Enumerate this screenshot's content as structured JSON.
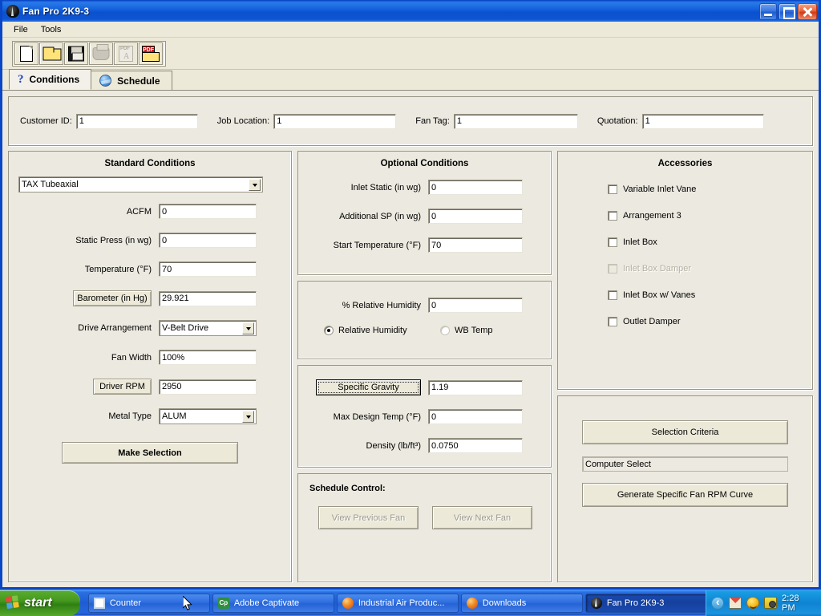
{
  "window": {
    "title": "Fan Pro 2K9-3",
    "icon": "fan-icon",
    "controls": {
      "minimize": "Minimize",
      "maximize": "Maximize",
      "close": "Close"
    }
  },
  "menu": {
    "items": [
      {
        "label": "File"
      },
      {
        "label": "Tools"
      }
    ]
  },
  "toolbar": {
    "buttons": [
      {
        "name": "new-file-button",
        "icon": "new-document-icon",
        "enabled": true
      },
      {
        "name": "open-file-button",
        "icon": "open-folder-icon",
        "enabled": true
      },
      {
        "name": "save-file-button",
        "icon": "floppy-save-icon",
        "enabled": true
      },
      {
        "name": "print-button",
        "icon": "printer-icon",
        "enabled": false
      },
      {
        "name": "pdf-view-button",
        "icon": "pdf-icon",
        "enabled": false
      },
      {
        "name": "pdf-export-button",
        "icon": "pdf-export-icon",
        "enabled": true
      }
    ]
  },
  "tabs": [
    {
      "label": "Conditions",
      "icon": "question-mark-icon",
      "active": true
    },
    {
      "label": "Schedule",
      "icon": "globe-icon",
      "active": false
    }
  ],
  "header_fields": [
    {
      "label": "Customer ID:",
      "value": "1"
    },
    {
      "label": "Job Location:",
      "value": "1"
    },
    {
      "label": "Fan Tag:",
      "value": "1"
    },
    {
      "label": "Quotation:",
      "value": "1"
    }
  ],
  "standard_conditions": {
    "title": "Standard Conditions",
    "fan_type": {
      "value": "TAX  Tubeaxial"
    },
    "fields": [
      {
        "label": "ACFM",
        "value": "0",
        "control": "textbox",
        "label_style": "plain"
      },
      {
        "label": "Static Press (in wg)",
        "value": "0",
        "control": "textbox",
        "label_style": "plain"
      },
      {
        "label": "Temperature (°F)",
        "value": "70",
        "control": "textbox",
        "label_style": "plain"
      },
      {
        "label": "Barometer (in Hg)",
        "value": "29.921",
        "control": "textbox",
        "label_style": "button"
      },
      {
        "label": "Drive Arrangement",
        "value": "V-Belt Drive",
        "control": "combobox",
        "label_style": "plain"
      },
      {
        "label": "Fan Width",
        "value": "100%",
        "control": "textbox",
        "label_style": "plain"
      },
      {
        "label": "Driver RPM",
        "value": "2950",
        "control": "textbox",
        "label_style": "button"
      },
      {
        "label": "Metal Type",
        "value": "ALUM",
        "control": "combobox",
        "label_style": "plain"
      }
    ],
    "make_selection_button": "Make Selection"
  },
  "optional_conditions": {
    "title": "Optional Conditions",
    "fields": [
      {
        "label": "Inlet Static (in wg)",
        "value": "0"
      },
      {
        "label": "Additional SP (in wg)",
        "value": "0"
      },
      {
        "label": "Start Temperature (°F)",
        "value": "70"
      }
    ],
    "humidity": {
      "field_label": "% Relative Humidity",
      "field_value": "0",
      "radios": [
        {
          "label": "Relative Humidity",
          "checked": true,
          "enabled": true
        },
        {
          "label": "WB Temp",
          "checked": false,
          "enabled": false
        }
      ]
    },
    "gravity": {
      "specific_gravity_button": "Specific Gravity",
      "specific_gravity_value": "1.19",
      "fields": [
        {
          "label": "Max Design Temp (°F)",
          "value": "0"
        },
        {
          "label": "Density (lb/ft³)",
          "value": "0.0750"
        }
      ]
    },
    "schedule_control": {
      "title": "Schedule Control:",
      "buttons": [
        {
          "label": "View Previous Fan",
          "enabled": false
        },
        {
          "label": "View Next Fan",
          "enabled": false
        }
      ]
    }
  },
  "accessories": {
    "title": "Accessories",
    "items": [
      {
        "label": "Variable Inlet Vane",
        "checked": false,
        "enabled": true
      },
      {
        "label": "Arrangement 3",
        "checked": false,
        "enabled": true
      },
      {
        "label": "Inlet Box",
        "checked": false,
        "enabled": true
      },
      {
        "label": "Inlet Box Damper",
        "checked": false,
        "enabled": false
      },
      {
        "label": "Inlet Box w/ Vanes",
        "checked": false,
        "enabled": true
      },
      {
        "label": "Outlet Damper",
        "checked": false,
        "enabled": true
      }
    ]
  },
  "selection": {
    "criteria_button": "Selection Criteria",
    "mode_value": "Computer Select",
    "curve_button": "Generate Specific Fan RPM Curve"
  },
  "taskbar": {
    "start_label": "start",
    "tasks": [
      {
        "label": "Counter",
        "icon": "window-icon",
        "active": false
      },
      {
        "label": "Adobe Captivate",
        "icon": "captivate-icon",
        "active": false
      },
      {
        "label": "Industrial Air Produc...",
        "icon": "firefox-icon",
        "active": false
      },
      {
        "label": "Downloads",
        "icon": "firefox-icon",
        "active": false
      },
      {
        "label": "Fan Pro 2K9-3",
        "icon": "fan-icon",
        "active": true
      }
    ],
    "tray_icons": [
      "chevron-left-icon",
      "mail-icon",
      "smiley-icon",
      "camera-icon"
    ],
    "clock": "2:28 PM"
  },
  "colors": {
    "title_blue": "#0a51cf",
    "face": "#ece9e0",
    "accent_green": "#3f8f1f"
  }
}
